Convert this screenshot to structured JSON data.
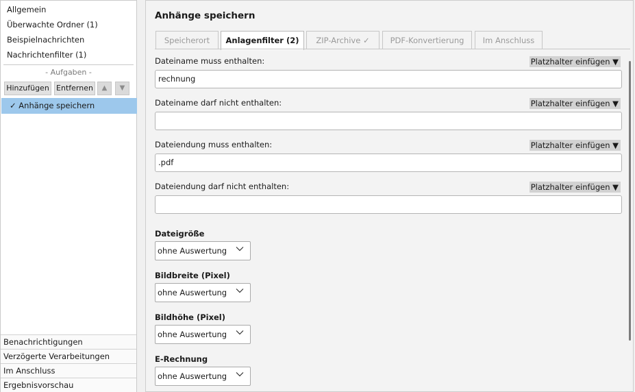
{
  "sidebar": {
    "items": [
      "Allgemein",
      "Überwachte Ordner (1)",
      "Beispielnachrichten",
      "Nachrichtenfilter (1)"
    ],
    "tasks_label": "- Aufgaben -",
    "add_button": "Hinzufügen",
    "remove_button": "Entfernen",
    "move_up_glyph": "▲",
    "move_down_glyph": "▼",
    "selected_task": "✓ Anhänge speichern",
    "bottom_items": [
      "Benachrichtigungen",
      "Verzögerte Verarbeitungen",
      "Im Anschluss",
      "Ergebnisvorschau"
    ]
  },
  "main": {
    "title": "Anhänge speichern",
    "tabs": [
      {
        "label": "Speicherort",
        "active": false
      },
      {
        "label": "Anlagenfilter (2)",
        "active": true
      },
      {
        "label": "ZIP-Archive ✓",
        "active": false
      },
      {
        "label": "PDF-Konvertierung",
        "active": false
      },
      {
        "label": "Im Anschluss",
        "active": false
      }
    ],
    "placeholder_button": "Platzhalter einfügen ▼",
    "fields": [
      {
        "label": "Dateiname muss enthalten:",
        "value": "rechnung"
      },
      {
        "label": "Dateiname darf nicht enthalten:",
        "value": ""
      },
      {
        "label": "Dateiendung muss enthalten:",
        "value": ".pdf"
      },
      {
        "label": "Dateiendung darf nicht enthalten:",
        "value": ""
      }
    ],
    "filters": [
      {
        "label": "Dateigröße",
        "value": "ohne Auswertung"
      },
      {
        "label": "Bildbreite (Pixel)",
        "value": "ohne Auswertung"
      },
      {
        "label": "Bildhöhe (Pixel)",
        "value": "ohne Auswertung"
      },
      {
        "label": "E-Rechnung",
        "value": "ohne Auswertung"
      }
    ]
  },
  "icons": {
    "combo_chevron": "chevron-down-icon",
    "selected_check": "checkmark-icon"
  },
  "colors": {
    "selection": "#9dc8ec",
    "panel_bg": "#f3f3f3",
    "placeholder_btn": "#d2d2d2"
  }
}
